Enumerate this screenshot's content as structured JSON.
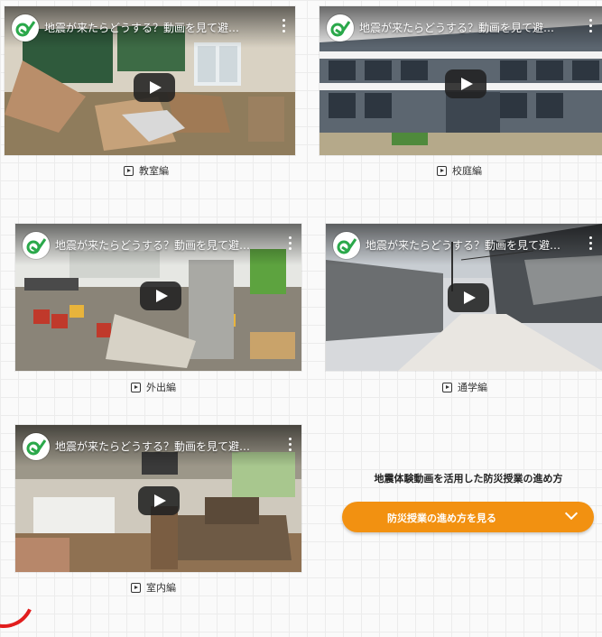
{
  "videos": [
    {
      "title": "地震が来たらどうする？動画を見て避…",
      "caption": "教室編"
    },
    {
      "title": "地震が来たらどうする？動画を見て避…",
      "caption": "校庭編"
    },
    {
      "title": "地震が来たらどうする？動画を見て避…",
      "caption": "外出編"
    },
    {
      "title": "地震が来たらどうする？動画を見て避…",
      "caption": "通学編"
    },
    {
      "title": "地震が来たらどうする？動画を見て避…",
      "caption": "室内編"
    }
  ],
  "howto": {
    "title": "地震体験動画を活用した防災授業の進め方",
    "button_label": "防災授業の進め方を見る"
  },
  "colors": {
    "accent": "#f29111",
    "brand_green": "#2aa84a",
    "annotation_red": "#e11d1d"
  },
  "icons": {
    "caption_icon": "play-square-icon",
    "button_icon": "chevron-down-icon",
    "video_icon": "play-button-icon"
  }
}
